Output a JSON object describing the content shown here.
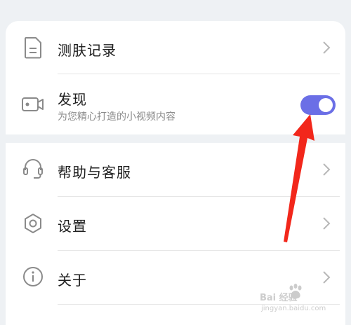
{
  "menu_top": [
    {
      "label": "测肤记录",
      "icon": "document-icon",
      "control": "chevron"
    },
    {
      "label": "发现",
      "sublabel": "为您精心打造的小视频内容",
      "icon": "video-camera-icon",
      "control": "toggle",
      "toggle_on": true
    }
  ],
  "menu_bottom": [
    {
      "label": "帮助与客服",
      "icon": "headset-icon",
      "control": "chevron"
    },
    {
      "label": "设置",
      "icon": "gear-icon",
      "control": "chevron"
    },
    {
      "label": "关于",
      "icon": "info-icon",
      "control": "chevron"
    }
  ],
  "annotation": {
    "type": "red-arrow",
    "points_to": "toggle",
    "color": "#f2271b"
  },
  "watermark": {
    "text": "Bai 经验",
    "url": "jingyan.baidu.com"
  },
  "colors": {
    "toggle_on": "#6b6fe6",
    "background": "#eef1f4",
    "text": "#1f1f1f",
    "subtext": "#8a8a8a"
  }
}
